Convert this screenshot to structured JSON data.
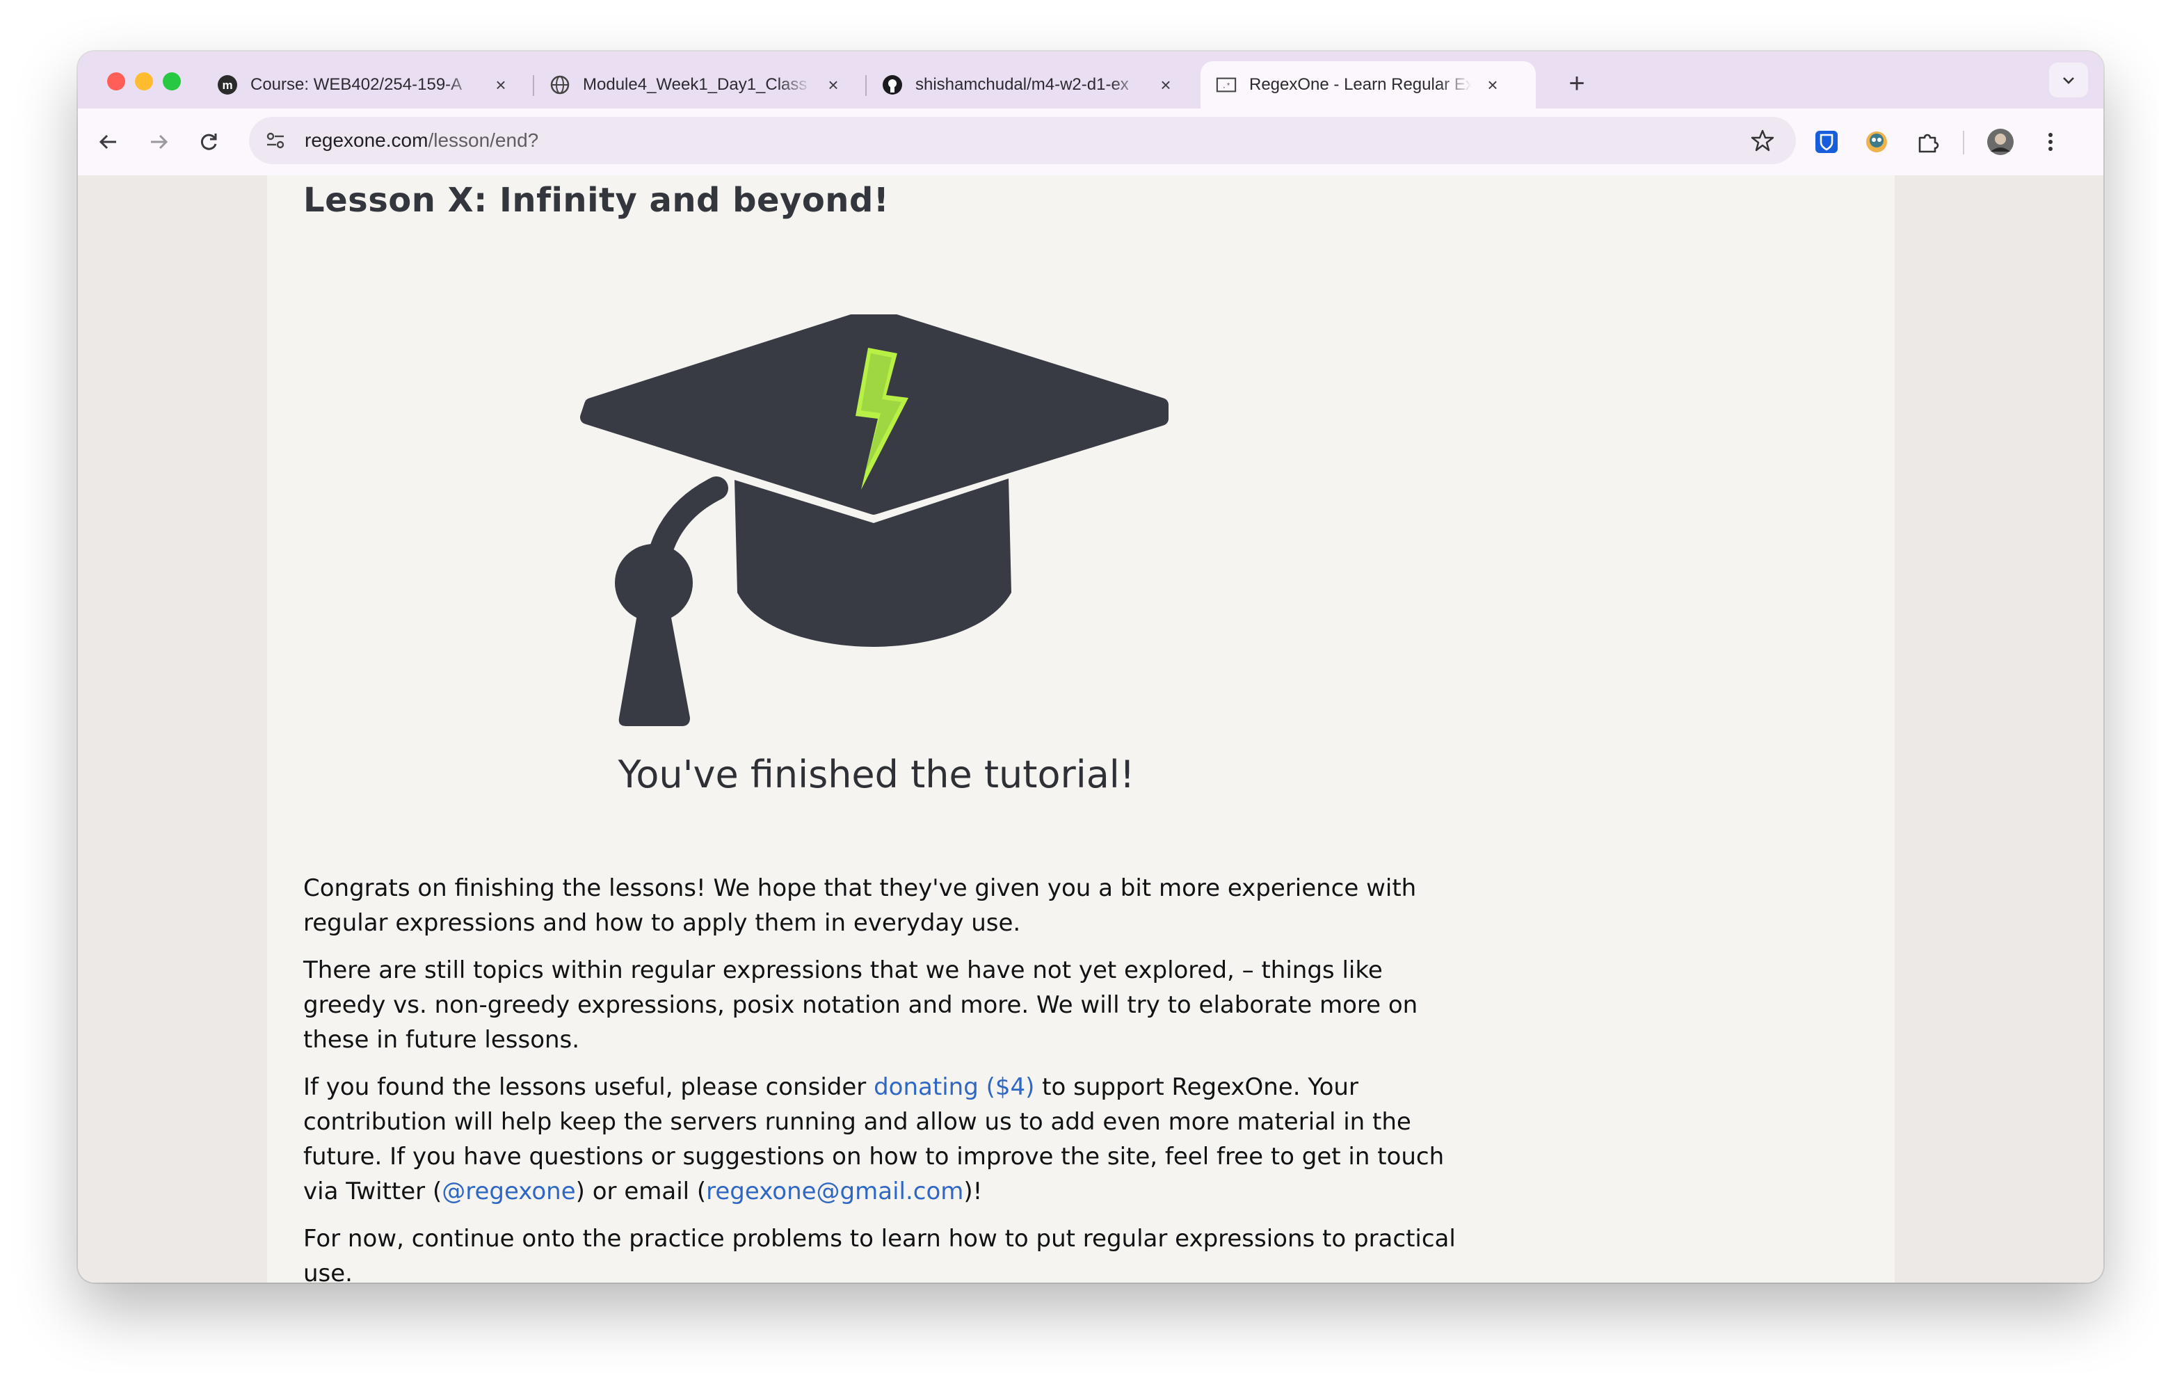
{
  "browser": {
    "tabs": [
      {
        "title": "Course: WEB402/254-159-A",
        "icon": "moodle-icon",
        "active": false
      },
      {
        "title": "Module4_Week1_Day1_Class",
        "icon": "globe-icon",
        "active": false
      },
      {
        "title": "shishamchudal/m4-w2-d1-ex",
        "icon": "github-icon",
        "active": false
      },
      {
        "title": "RegexOne - Learn Regular Ex",
        "icon": "regexone-icon",
        "active": true
      }
    ],
    "new_tab_label": "+",
    "tab_search_label": "⌄",
    "url": {
      "domain": "regexone.com",
      "path": "/lesson/end?"
    }
  },
  "page": {
    "lesson_title": "Lesson X: Infinity and beyond!",
    "finished_heading": "You've finished the tutorial!",
    "para1": "Congrats on finishing the lessons! We hope that they've given you a bit more experience with regular expressions and how to apply them in everyday use.",
    "para2": "There are still topics within regular expressions that we have not yet explored, – things like greedy vs. non-greedy expressions, posix notation and more. We will try to elaborate more on these in future lessons.",
    "para3": {
      "before_link": "If you found the lessons useful, please consider ",
      "donate_link": "donating ($4)",
      "after_donate": " to support RegexOne. Your contribution will help keep the servers running and allow us to add even more material in the future. If you have questions or suggestions on how to improve the site, feel free to get in touch via Twitter (",
      "twitter_link": "@regexone",
      "after_twitter": ") or email (",
      "email_link": "regexone@gmail.com",
      "end": ")!"
    },
    "para4": "For now, continue onto the practice problems to learn how to put regular expressions to practical use."
  },
  "colors": {
    "link": "#2f67c4",
    "cap": "#383b44",
    "bolt": "#a8e43a",
    "tab_strip": "#eadff2"
  }
}
